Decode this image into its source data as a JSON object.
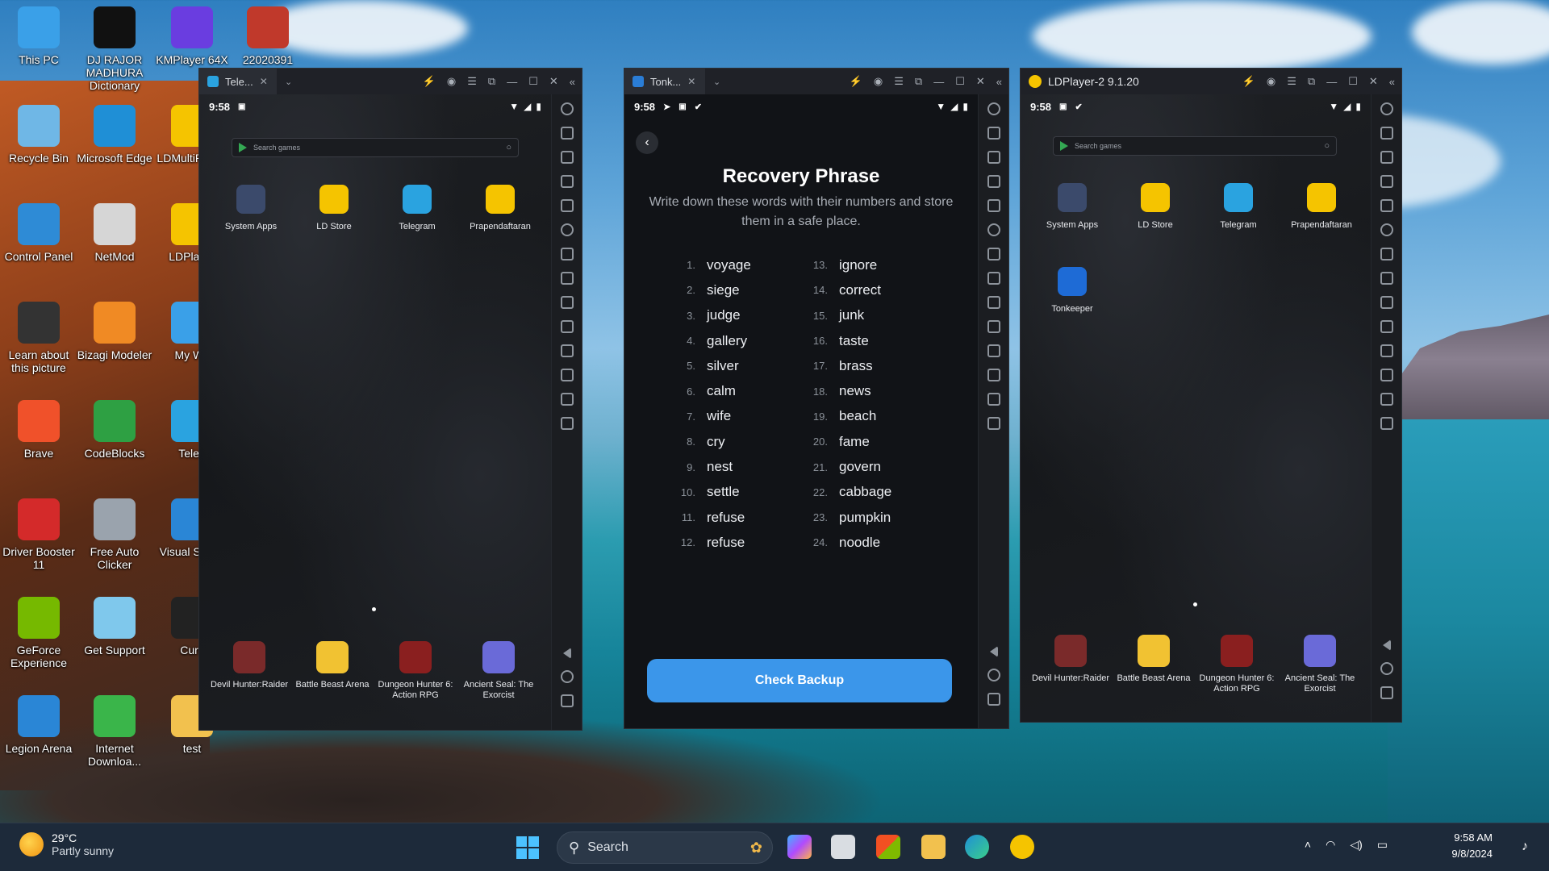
{
  "desktop_icons": [
    {
      "label": "This PC",
      "icon": "monitor-icon",
      "color": "#3aa0e8"
    },
    {
      "label": "DJ RAJOR MADHURA Dictionary",
      "icon": "dictionary-icon",
      "color": "#111111"
    },
    {
      "label": "KMPlayer 64X",
      "icon": "kmplayer-icon",
      "color": "#6a3de0"
    },
    {
      "label": "22020391",
      "icon": "winrar-icon",
      "color": "#c0392b"
    },
    {
      "label": "Recycle Bin",
      "icon": "recycle-bin-icon",
      "color": "#6fb7e6"
    },
    {
      "label": "Microsoft Edge",
      "icon": "edge-icon",
      "color": "#1f8fd6"
    },
    {
      "label": "LDMultiPlayer",
      "icon": "ldmulti-icon",
      "color": "#f5c400"
    },
    {
      "label": "Control Panel",
      "icon": "control-panel-icon",
      "color": "#2e8bd6"
    },
    {
      "label": "NetMod",
      "icon": "netmod-icon",
      "color": "#d6d6d6"
    },
    {
      "label": "LDPlayer",
      "icon": "ldplayer-icon",
      "color": "#f5c400"
    },
    {
      "label": "Learn about this picture",
      "icon": "learn-icon",
      "color": "#333333"
    },
    {
      "label": "Bizagi Modeler",
      "icon": "bizagi-icon",
      "color": "#f08a24"
    },
    {
      "label": "My Wa",
      "icon": "mywa-icon",
      "color": "#3aa0e8"
    },
    {
      "label": "Brave",
      "icon": "brave-icon",
      "color": "#f0512a"
    },
    {
      "label": "CodeBlocks",
      "icon": "codeblocks-icon",
      "color": "#2ea043"
    },
    {
      "label": "Teleg",
      "icon": "telegram-icon",
      "color": "#2aa3e0"
    },
    {
      "label": "Driver Booster 11",
      "icon": "driver-booster-icon",
      "color": "#d42a2a"
    },
    {
      "label": "Free Auto Clicker",
      "icon": "mouse-icon",
      "color": "#9aa3ad"
    },
    {
      "label": "Visual S Cod",
      "icon": "vscode-icon",
      "color": "#2a86d6"
    },
    {
      "label": "GeForce Experience",
      "icon": "geforce-icon",
      "color": "#76b900"
    },
    {
      "label": "Get Support",
      "icon": "support-icon",
      "color": "#7fc8ec"
    },
    {
      "label": "Curs",
      "icon": "cursor-icon",
      "color": "#222222"
    },
    {
      "label": "Legion Arena",
      "icon": "legion-icon",
      "color": "#2a86d6"
    },
    {
      "label": "Internet Downloa...",
      "icon": "idm-icon",
      "color": "#3ab54a"
    },
    {
      "label": "test",
      "icon": "folder-icon",
      "color": "#f2c14e"
    }
  ],
  "window1": {
    "tab": "Tele...",
    "time": "9:58",
    "search_placeholder": "Search games",
    "apps": [
      "System Apps",
      "LD Store",
      "Telegram",
      "Prapendaftaran"
    ],
    "games": [
      "Devil Hunter:Raider",
      "Battle Beast Arena",
      "Dungeon Hunter 6: Action RPG",
      "Ancient Seal: The Exorcist"
    ]
  },
  "window2": {
    "tab": "Tonk...",
    "time": "9:58",
    "title": "Recovery Phrase",
    "subtitle": "Write down these words with their numbers and store them in a safe place.",
    "words_left": [
      {
        "n": "1.",
        "w": "voyage"
      },
      {
        "n": "2.",
        "w": "siege"
      },
      {
        "n": "3.",
        "w": "judge"
      },
      {
        "n": "4.",
        "w": "gallery"
      },
      {
        "n": "5.",
        "w": "silver"
      },
      {
        "n": "6.",
        "w": "calm"
      },
      {
        "n": "7.",
        "w": "wife"
      },
      {
        "n": "8.",
        "w": "cry"
      },
      {
        "n": "9.",
        "w": "nest"
      },
      {
        "n": "10.",
        "w": "settle"
      },
      {
        "n": "11.",
        "w": "refuse"
      },
      {
        "n": "12.",
        "w": "refuse"
      }
    ],
    "words_right": [
      {
        "n": "13.",
        "w": "ignore"
      },
      {
        "n": "14.",
        "w": "correct"
      },
      {
        "n": "15.",
        "w": "junk"
      },
      {
        "n": "16.",
        "w": "taste"
      },
      {
        "n": "17.",
        "w": "brass"
      },
      {
        "n": "18.",
        "w": "news"
      },
      {
        "n": "19.",
        "w": "beach"
      },
      {
        "n": "20.",
        "w": "fame"
      },
      {
        "n": "21.",
        "w": "govern"
      },
      {
        "n": "22.",
        "w": "cabbage"
      },
      {
        "n": "23.",
        "w": "pumpkin"
      },
      {
        "n": "24.",
        "w": "noodle"
      }
    ],
    "button": "Check Backup",
    "accent": "#3b96ea"
  },
  "window3": {
    "title": "LDPlayer-2 9.1.20",
    "time": "9:58",
    "search_placeholder": "Search games",
    "apps": [
      "System Apps",
      "LD Store",
      "Telegram",
      "Prapendaftaran",
      "Tonkeeper"
    ],
    "games": [
      "Devil Hunter:Raider",
      "Battle Beast Arena",
      "Dungeon Hunter 6: Action RPG",
      "Ancient Seal: The Exorcist"
    ]
  },
  "taskbar": {
    "temperature": "29°C",
    "weather": "Partly sunny",
    "search": "Search",
    "time": "9:58 AM",
    "date": "9/8/2024"
  }
}
